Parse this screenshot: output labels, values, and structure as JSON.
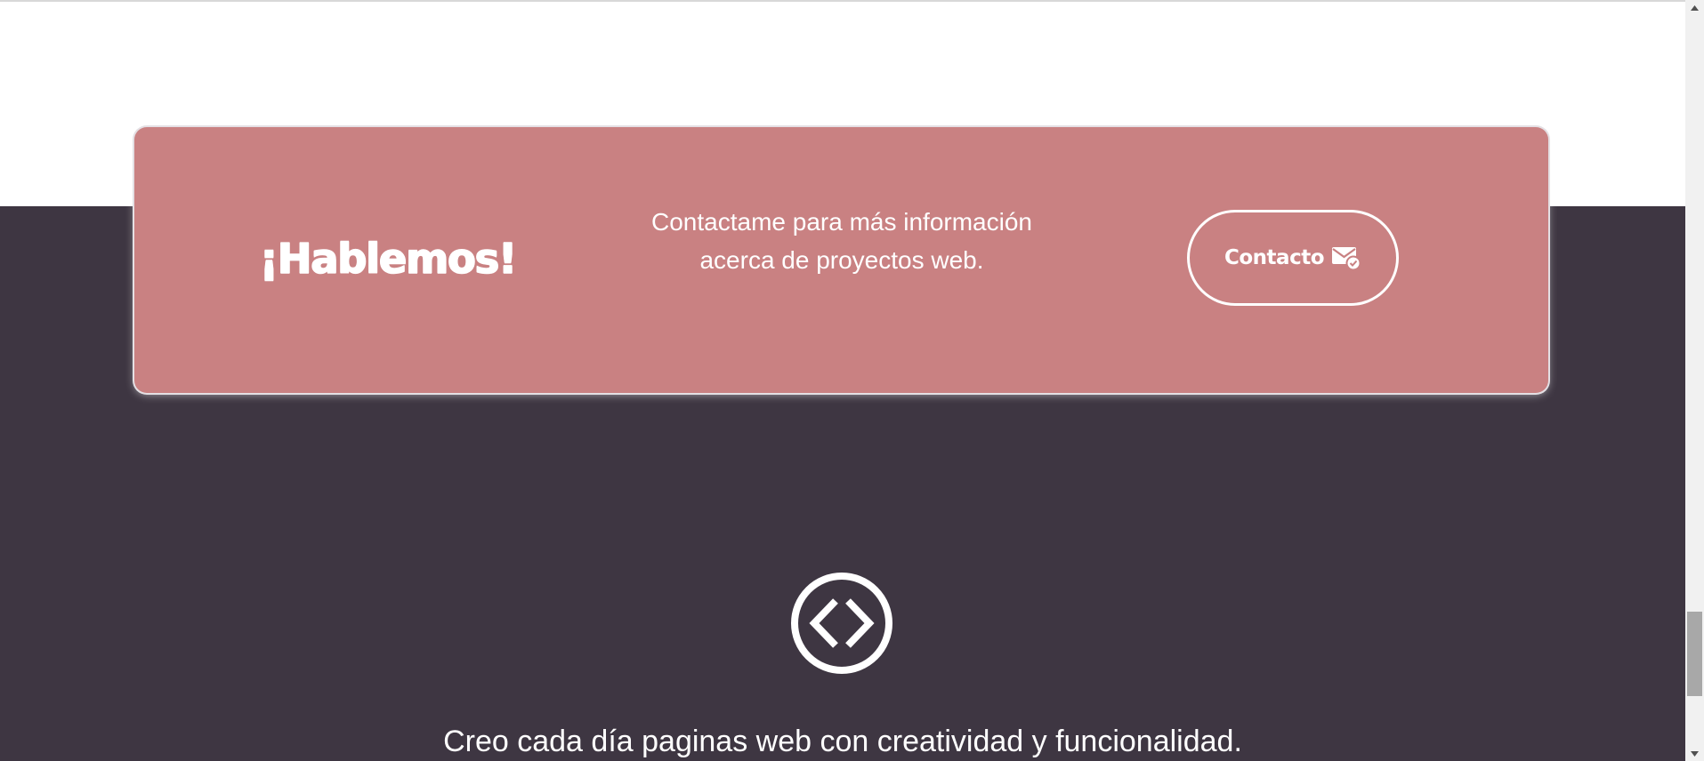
{
  "cta": {
    "title": "¡Hablemos!",
    "text": "Contactame para más información acerca de proyectos web.",
    "button_label": "Contacto"
  },
  "footer": {
    "tagline": "Creo cada día paginas web con creatividad y funcionalidad."
  },
  "icons": {
    "button_icon": "mail-check-icon",
    "section_icon": "code-brackets-icon"
  },
  "colors": {
    "card": "#c98182",
    "dark_background": "#3e3642",
    "text": "#ffffff"
  }
}
